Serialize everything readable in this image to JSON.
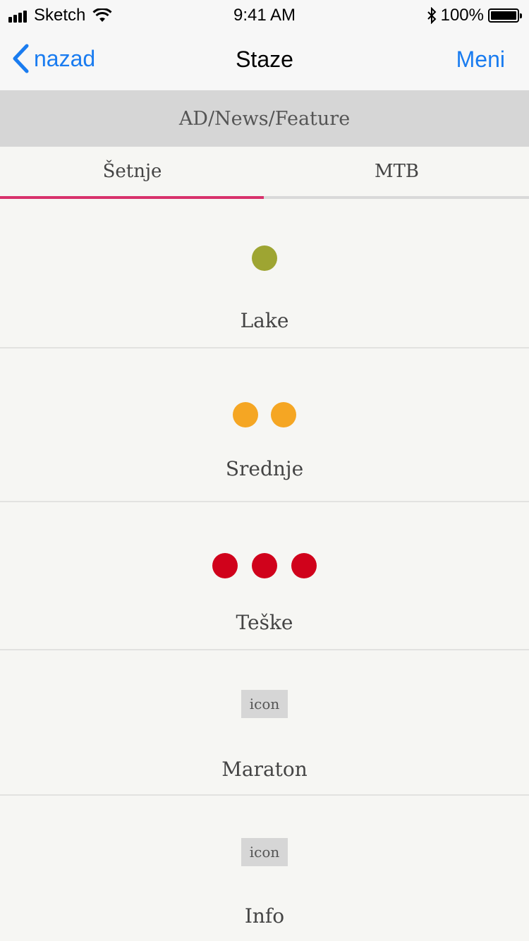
{
  "status_bar": {
    "carrier": "Sketch",
    "time": "9:41 AM",
    "battery": "100%"
  },
  "nav": {
    "back_label": "nazad",
    "title": "Staze",
    "menu_label": "Meni"
  },
  "ad_banner": "AD/News/Feature",
  "tabs": [
    {
      "label": "Šetnje",
      "active": true
    },
    {
      "label": "MTB",
      "active": false
    }
  ],
  "accent_color": "#d8316b",
  "link_color": "#1a7cf0",
  "categories": [
    {
      "label": "Lake",
      "dot_count": 1,
      "dot_color": "#9ea532"
    },
    {
      "label": "Srednje",
      "dot_count": 2,
      "dot_color": "#f5a623"
    },
    {
      "label": "Teške",
      "dot_count": 3,
      "dot_color": "#d0021b"
    },
    {
      "label": "Maraton",
      "icon_text": "icon"
    },
    {
      "label": "Info",
      "icon_text": "icon"
    }
  ]
}
